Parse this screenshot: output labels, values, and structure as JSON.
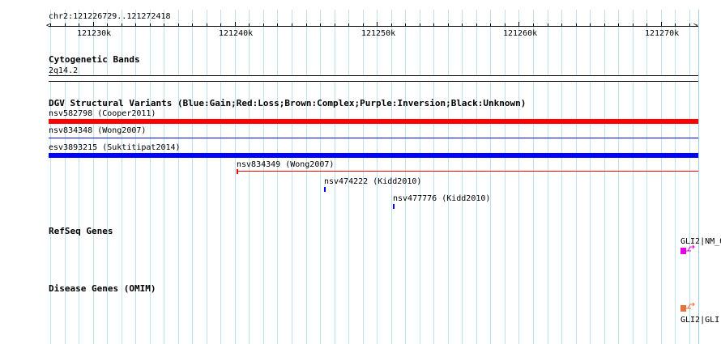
{
  "ruler": {
    "locus": "chr2:121226729..121272418",
    "ticks": [
      "121230k",
      "121240k",
      "121250k",
      "121260k",
      "121270k"
    ]
  },
  "tracks": {
    "cytobands": {
      "title": "Cytogenetic Bands",
      "band": "2q14.2"
    },
    "dgv": {
      "title": "DGV Structural Variants (Blue:Gain;Red:Loss;Brown:Complex;Purple:Inversion;Black:Unknown)",
      "features": [
        {
          "label": "nsv582798 (Cooper2011)",
          "color": "#ff0000"
        },
        {
          "label": "nsv834348 (Wong2007)",
          "color": "#0000ff"
        },
        {
          "label": "esv3893215 (Suktitipat2014)",
          "color": "#0000ff"
        },
        {
          "label": "nsv834349 (Wong2007)",
          "color": "#ff0000"
        },
        {
          "label": "nsv474222 (Kidd2010)",
          "color": "#0000ff"
        },
        {
          "label": "nsv477776 (Kidd2010)",
          "color": "#0000ff"
        }
      ]
    },
    "refseq": {
      "title": "RefSeq Genes",
      "gene_label": "GLI2|NM_0",
      "color": "#e600e6"
    },
    "omim": {
      "title": "Disease Genes (OMIM)",
      "gene_label": "GLI2|GLI",
      "color": "#e8703a"
    }
  }
}
